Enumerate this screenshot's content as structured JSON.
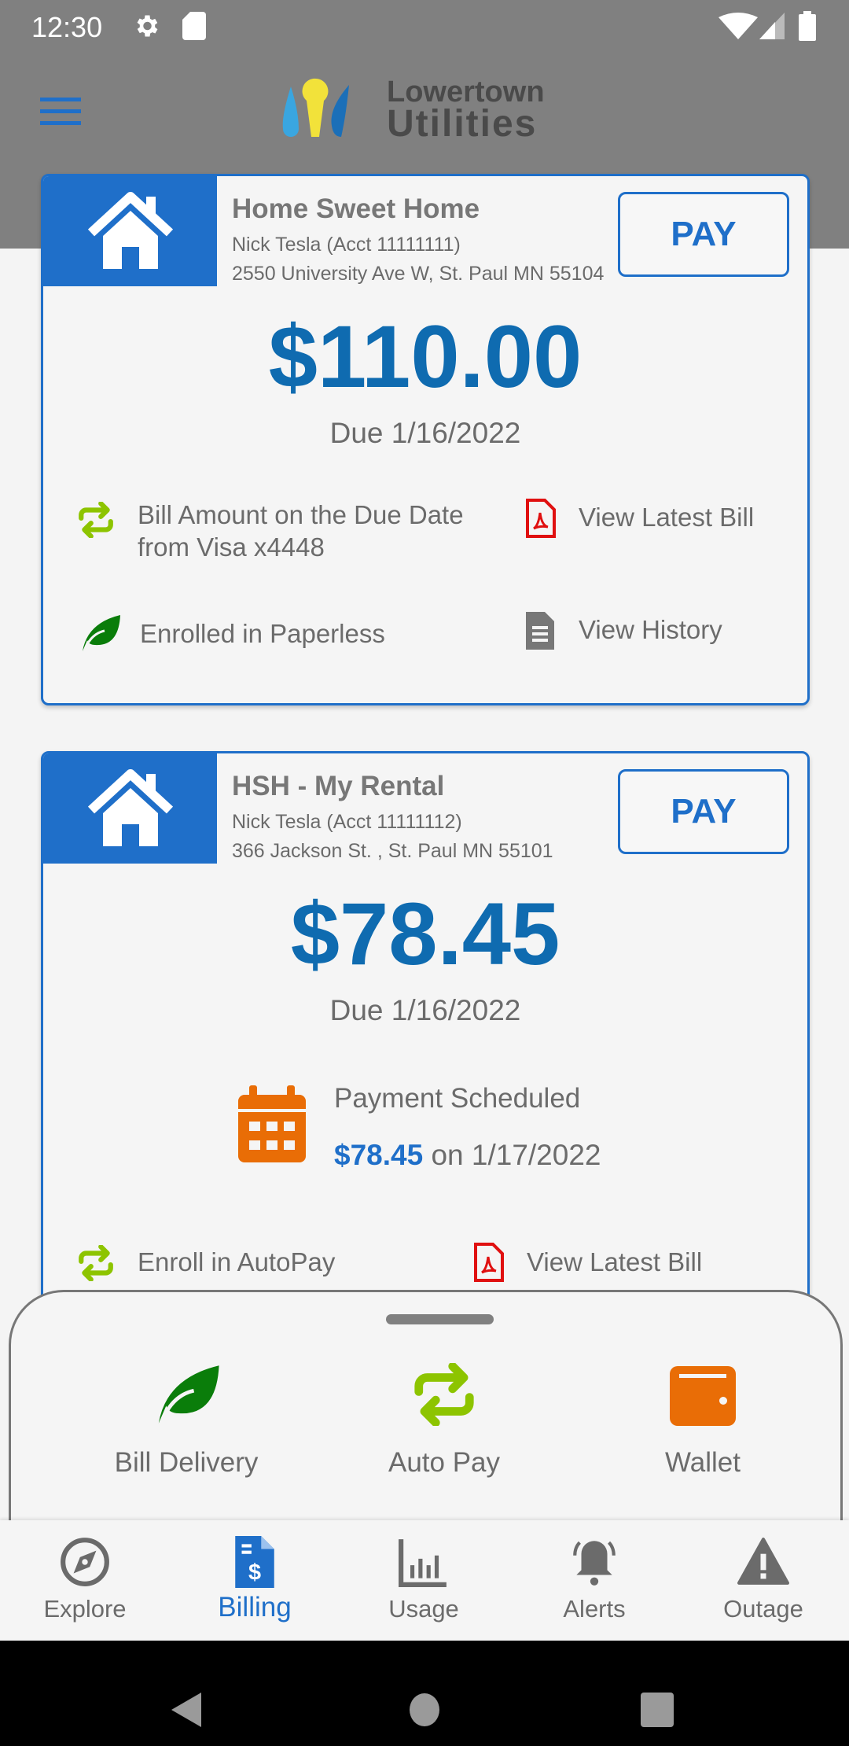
{
  "status_bar": {
    "time": "12:30",
    "icons": [
      "gear-icon",
      "sd-card-icon",
      "wifi-icon",
      "signal-icon",
      "battery-icon"
    ]
  },
  "header": {
    "logo_line1": "Lowertown",
    "logo_line2": "Utilities",
    "menu_icon": "hamburger-icon"
  },
  "colors": {
    "primary": "#1f6fc9",
    "amount": "#0f6bb0",
    "header": "#808080",
    "leaf": "#0a7d0a",
    "autopay": "#8dc400",
    "pdf": "#e01010",
    "calendar": "#e96d06",
    "wallet": "#e96d06"
  },
  "accounts": [
    {
      "name": "Home Sweet Home",
      "account": "Nick Tesla (Acct 11111111)",
      "address": "2550 University Ave W, St. Paul MN 55104",
      "pay_label": "PAY",
      "amount": "$110.00",
      "due": "Due 1/16/2022",
      "autopay_line1": "Bill Amount on the Due Date",
      "autopay_line2": "from Visa x4448",
      "view_bill": "View Latest Bill",
      "paperless": "Enrolled in Paperless",
      "view_history": "View History"
    },
    {
      "name": "HSH - My Rental",
      "account": "Nick Tesla (Acct 11111112)",
      "address": "366 Jackson St. , St. Paul MN 55101",
      "pay_label": "PAY",
      "amount": "$78.45",
      "due": "Due 1/16/2022",
      "scheduled_label": "Payment Scheduled",
      "scheduled_amount": "$78.45",
      "scheduled_date": "on 1/17/2022",
      "autopay": "Enroll in AutoPay",
      "view_bill": "View Latest Bill"
    }
  ],
  "sheet": {
    "items": [
      {
        "label": "Bill Delivery",
        "icon": "leaf-icon"
      },
      {
        "label": "Auto Pay",
        "icon": "autopay-icon"
      },
      {
        "label": "Wallet",
        "icon": "wallet-icon"
      }
    ]
  },
  "nav": {
    "active": "Billing",
    "items": [
      {
        "label": "Explore"
      },
      {
        "label": "Billing"
      },
      {
        "label": "Usage"
      },
      {
        "label": "Alerts"
      },
      {
        "label": "Outage"
      }
    ]
  }
}
